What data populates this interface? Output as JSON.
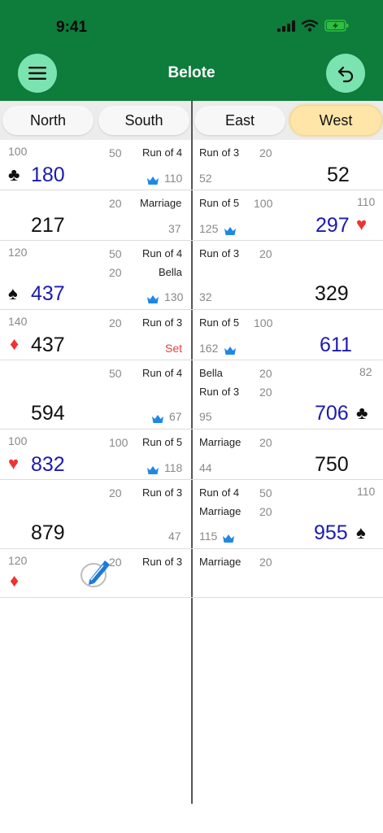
{
  "status": {
    "time": "9:41"
  },
  "header": {
    "title": "Belote"
  },
  "tabs": [
    {
      "label": "North"
    },
    {
      "label": "South"
    },
    {
      "label": "East"
    },
    {
      "label": "West"
    }
  ],
  "rows": [
    {
      "left": {
        "p1": "100",
        "p2": "50",
        "p3": "Run of 4",
        "suit": "♣",
        "total": "180",
        "crownval": "110"
      },
      "right": {
        "l1": "Run of 3",
        "v1": "20",
        "sub": "52",
        "total": "52"
      }
    },
    {
      "left": {
        "p2": "20",
        "p3": "Marriage",
        "total": "217",
        "r": "37"
      },
      "right": {
        "l1": "Run of 5",
        "v1": "100",
        "top": "110",
        "crownval": "125",
        "total": "297",
        "suit": "♥"
      }
    },
    {
      "left": {
        "p1": "120",
        "p2": "50",
        "p3": "Run of 4",
        "p4": "20",
        "p5": "Bella",
        "suit": "♠",
        "total": "437",
        "crownval": "130"
      },
      "right": {
        "l1": "Run of 3",
        "v1": "20",
        "sub": "32",
        "total": "329"
      }
    },
    {
      "left": {
        "p1": "140",
        "p2": "20",
        "p3": "Run of 3",
        "suit": "♦",
        "total": "437",
        "r": "Set"
      },
      "right": {
        "l1": "Run of 5",
        "v1": "100",
        "crownval": "162",
        "total": "611"
      }
    },
    {
      "left": {
        "p2": "50",
        "p3": "Run of 4",
        "total": "594",
        "crownval": "67"
      },
      "right": {
        "l1": "Bella",
        "v1": "20",
        "top": "82",
        "l2": "Run of 3",
        "v2": "20",
        "sub": "95",
        "total": "706",
        "suit": "♣"
      }
    },
    {
      "left": {
        "p1": "100",
        "p2": "100",
        "p3": "Run of 5",
        "suit": "♥",
        "total": "832",
        "crownval": "118"
      },
      "right": {
        "l1": "Marriage",
        "v1": "20",
        "sub": "44",
        "total": "750"
      }
    },
    {
      "left": {
        "p2": "20",
        "p3": "Run of 3",
        "total": "879",
        "r": "47"
      },
      "right": {
        "l1": "Run of 4",
        "v1": "50",
        "top": "110",
        "l2": "Marriage",
        "v2": "20",
        "crownval": "115",
        "total": "955",
        "suit": "♠"
      }
    },
    {
      "left": {
        "p1": "120",
        "p2": "20",
        "p3": "Run of 3",
        "suit": "♦"
      },
      "right": {
        "l1": "Marriage",
        "v1": "20"
      }
    }
  ],
  "colors": {
    "header": "#0e7c3a",
    "button": "#7be3b0",
    "accent_blue": "#1b1bb0",
    "red": "#e8413b",
    "active_tab": "#ffe6a8"
  },
  "icons": [
    "menu-icon",
    "undo-icon",
    "crown-icon",
    "pen-icon",
    "club-icon",
    "spade-icon",
    "heart-icon",
    "diamond-icon"
  ]
}
